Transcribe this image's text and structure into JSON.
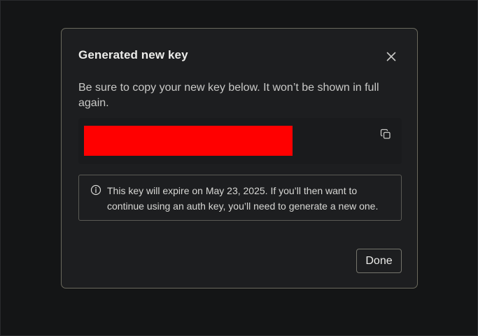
{
  "dialog": {
    "title": "Generated new key",
    "description": "Be sure to copy your new key below. It won’t be shown in full again.",
    "key": {
      "value": "[redacted]",
      "redaction_color": "#ff0000"
    },
    "notice": "This key will expire on May 23, 2025. If you’ll then want to continue using an auth key, you’ll need to generate a new one.",
    "done_label": "Done",
    "icons": {
      "close": "close-icon",
      "copy": "copy-icon",
      "info": "info-icon"
    }
  }
}
